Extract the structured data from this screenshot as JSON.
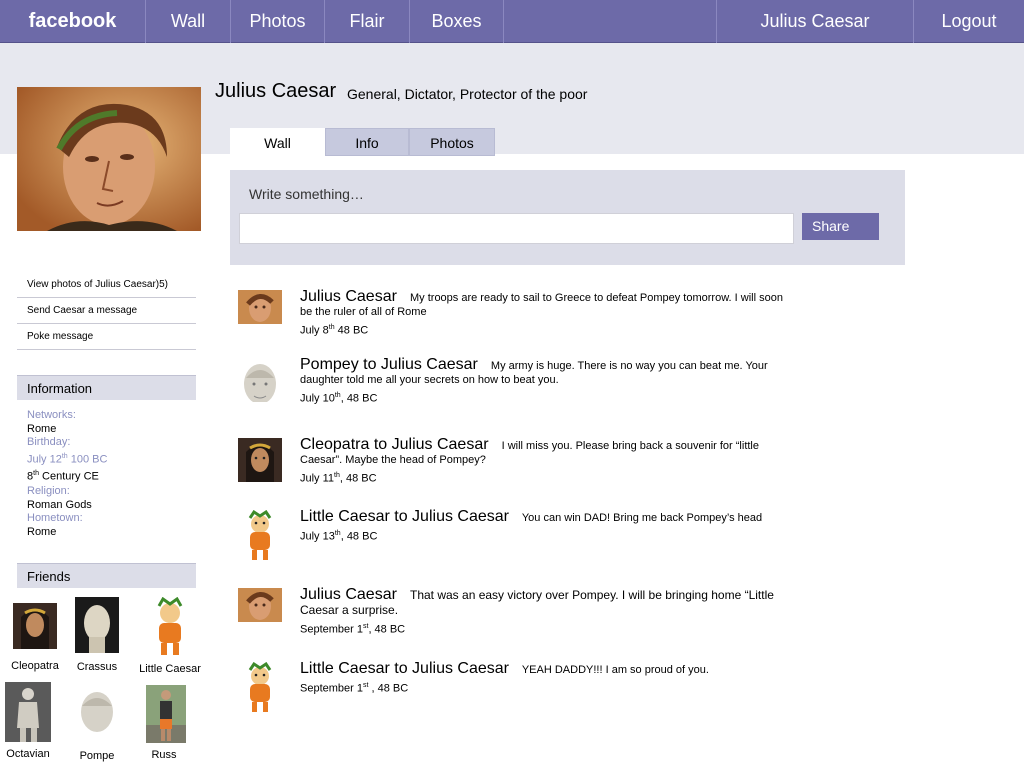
{
  "nav": {
    "brand": "facebook",
    "items": [
      "Wall",
      "Photos",
      "Flair",
      "Boxes"
    ],
    "user": "Julius Caesar",
    "logout": "Logout"
  },
  "profile": {
    "name": "Julius Caesar",
    "tagline": "General, Dictator, Protector of the poor",
    "tabs": [
      "Wall",
      "Info",
      "Photos"
    ],
    "active_tab": "Wall"
  },
  "composer": {
    "prompt": "Write something…",
    "input_value": "",
    "share_label": "Share"
  },
  "sidebar": {
    "links": [
      "View photos of Julius Caesar)5)",
      "Send Caesar a message",
      "Poke message"
    ],
    "information_title": "Information",
    "info": [
      {
        "label": "Networks:",
        "value": "Rome"
      },
      {
        "label": "Birthday:",
        "value_main": "July 12",
        "value_sup": "th",
        "value_rest": " 100 BC"
      },
      {
        "extra_main": "8",
        "extra_sup": "th",
        "extra_rest": " Century CE"
      },
      {
        "label": "Religion:",
        "value": "Roman Gods"
      },
      {
        "label": "Hometown:",
        "value": "Rome"
      }
    ],
    "friends_title": "Friends",
    "friends": [
      "Cleopatra",
      "Crassus",
      "Little Caesar",
      "Octavian",
      "Pompe",
      "Russ"
    ]
  },
  "posts": [
    {
      "who": "Julius Caesar",
      "msg": "My troops are ready to sail to Greece to defeat Pompey tomorrow. I will soon be the ruler of all of Rome",
      "date_main": "July 8",
      "date_sup": "th",
      "date_rest": "  48 BC",
      "avatar": "caesar-avatar"
    },
    {
      "who": "Pompey to Julius Caesar",
      "msg": "My army is huge.  There is no  way you can beat me. Your daughter told me all your secrets on how to beat you.",
      "date_main": "July 10",
      "date_sup": "th",
      "date_rest": ", 48 BC",
      "avatar": "pompey-avatar"
    },
    {
      "who": "Cleopatra to Julius Caesar",
      "msg": "I will miss you.  Please bring back a souvenir  for “little Caesar”.  Maybe the head of  Pompey?",
      "date_main": "July 11",
      "date_sup": "th",
      "date_rest": ", 48 BC",
      "avatar": "cleopatra-avatar"
    },
    {
      "who": "Little Caesar to Julius Caesar",
      "msg": "You can win DAD!  Bring me back Pompey’s head",
      "date_main": "July 13",
      "date_sup": "th",
      "date_rest": ", 48 BC",
      "avatar": "little-caesar-avatar"
    },
    {
      "who": "Julius Caesar",
      "msg": "That was an easy victory over Pompey. I will be bringing home “Little Caesar a surprise.",
      "date_main": "September 1",
      "date_sup": "st",
      "date_rest": ", 48 BC",
      "avatar": "caesar-avatar"
    },
    {
      "who": "Little Caesar to Julius Caesar",
      "msg": "YEAH  DADDY!!!  I am so proud of you.",
      "date_main": "September 1",
      "date_sup": "st",
      "date_rest": " , 48 BC",
      "avatar": "little-caesar-avatar"
    }
  ],
  "colors": {
    "brand": "#6d6aa8",
    "band": "#e7e8ef",
    "panel": "#dcdde8",
    "label": "#8a8fc0"
  }
}
